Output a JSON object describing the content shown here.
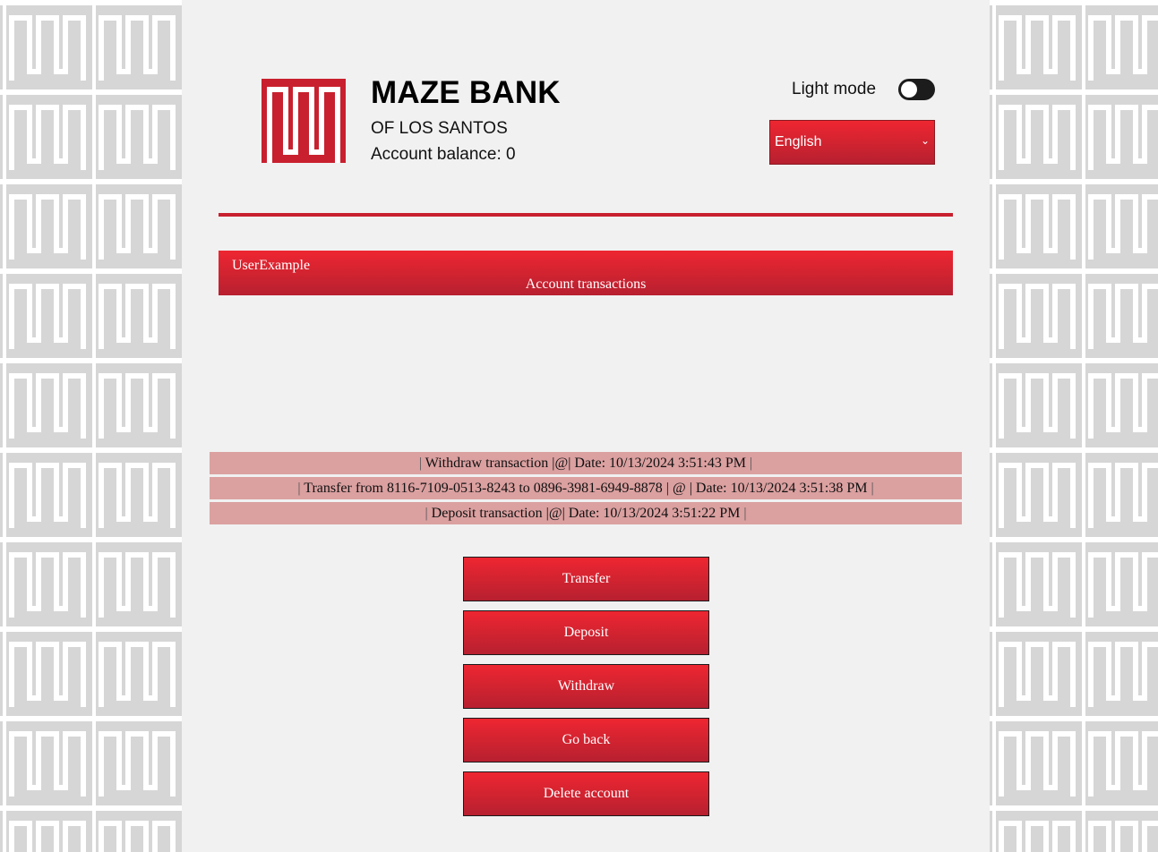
{
  "header": {
    "bank_name": "MAZE BANK",
    "bank_subtitle": "OF LOS SANTOS",
    "balance_text": "Account balance: 0",
    "mode_label": "Light mode",
    "mode_on": false,
    "language": "English"
  },
  "account": {
    "username": "UserExample",
    "section_title": "Account transactions"
  },
  "transactions": [
    "Withdraw transaction |@| Date: 10/13/2024 3:51:43 PM",
    "Transfer from 8116-7109-0513-8243 to 0896-3981-6949-8878 | @ | Date: 10/13/2024 3:51:38 PM",
    "Deposit transaction |@| Date: 10/13/2024 3:51:22 PM"
  ],
  "actions": {
    "transfer": "Transfer",
    "deposit": "Deposit",
    "withdraw": "Withdraw",
    "go_back": "Go back",
    "delete_account": "Delete account"
  },
  "colors": {
    "brand_red": "#c8202e",
    "transaction_row": "#dba0a0",
    "page_bg": "#f1f1f1",
    "pattern_bg": "#d6d6d6"
  }
}
